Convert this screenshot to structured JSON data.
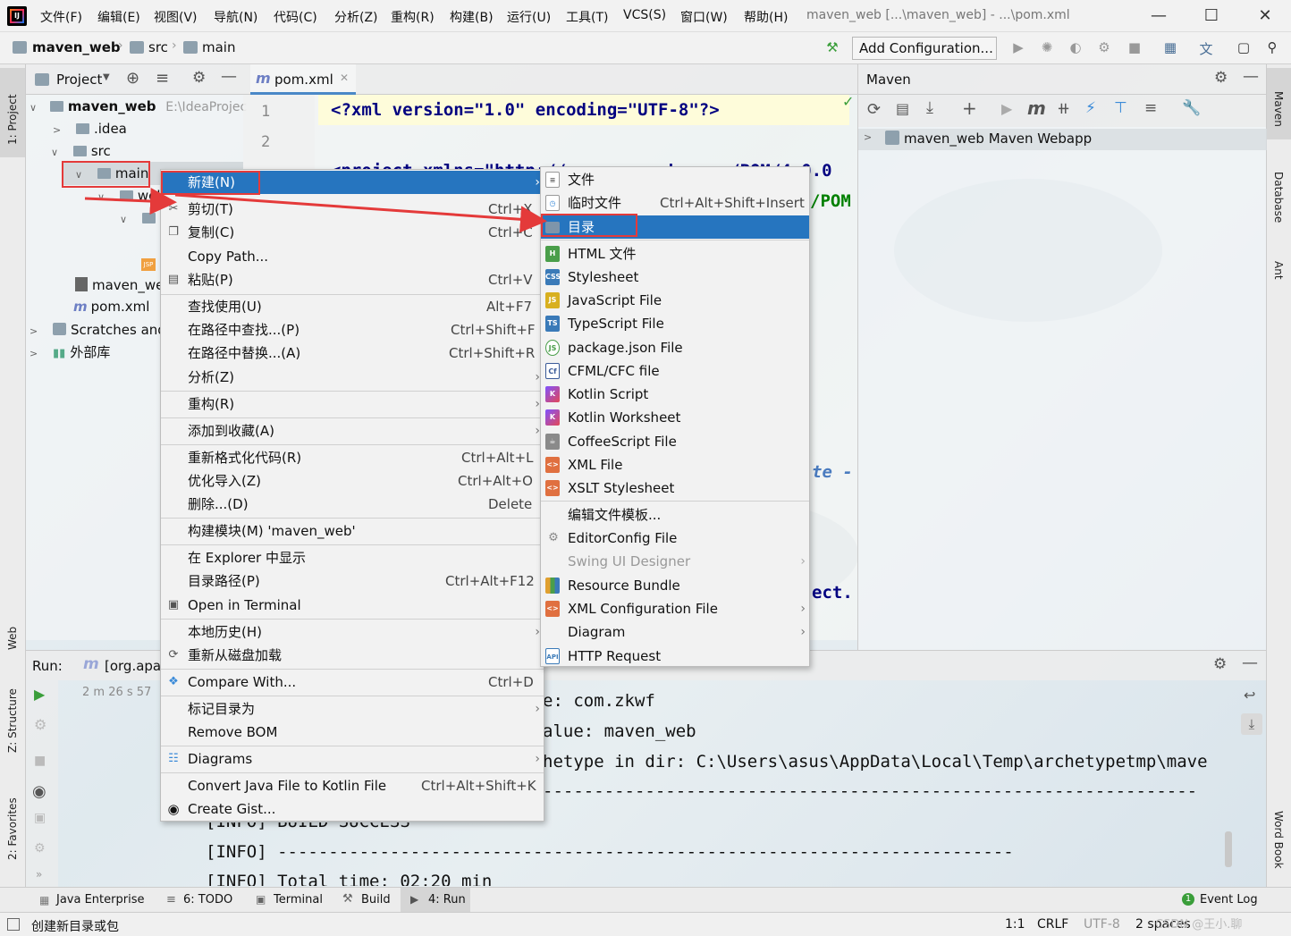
{
  "menubar": {
    "items": [
      "文件(F)",
      "编辑(E)",
      "视图(V)",
      "导航(N)",
      "代码(C)",
      "分析(Z)",
      "重构(R)",
      "构建(B)",
      "运行(U)",
      "工具(T)",
      "VCS(S)",
      "窗口(W)",
      "帮助(H)"
    ],
    "window_title": "maven_web [...\\maven_web] - ...\\pom.xml"
  },
  "navbar": {
    "crumbs": [
      "maven_web",
      "src",
      "main"
    ],
    "add_config": "Add Configuration..."
  },
  "left_stripe": {
    "project": "1: Project",
    "web": "Web",
    "structure": "Z: Structure",
    "favorites": "2: Favorites"
  },
  "right_stripe": {
    "maven": "Maven",
    "database": "Database",
    "ant": "Ant",
    "wordbook": "Word Book"
  },
  "project": {
    "title": "Project",
    "tree": {
      "root": "maven_web",
      "root_path": "E:\\IdeaProjec",
      "idea": ".idea",
      "src": "src",
      "main": "main",
      "web": "web",
      "iml": "maven_we",
      "pom": "pom.xml",
      "scratches": "Scratches and",
      "extlib": "外部库"
    }
  },
  "editor": {
    "tab": "pom.xml",
    "line1": "1",
    "line2": "2",
    "code_line1": "<?xml version=\"1.0\" encoding=\"UTF-8\"?>",
    "code_line3_frag": "<project xmlns=\"http://maven.apache.org/POM/4.0.0",
    "frag_pom": "/POM",
    "frag_te": "te -",
    "frag_ect": "ect."
  },
  "maven": {
    "title": "Maven",
    "project": "maven_web Maven Webapp"
  },
  "run": {
    "label": "Run:",
    "config": "[org.apa",
    "time": "2 m 26 s 57",
    "lines": [
      "e: com.zkwf",
      "alue: maven_web",
      "hetype in dir: C:\\Users\\asus\\AppData\\Local\\Temp\\archetypetmp\\mave",
      "----------------------------------------------------------------",
      "[INFO] BUILD SUCCESS",
      "[INFO] ------------------------------------------------------------------------",
      "[INFO] Total time: 02:20 min"
    ]
  },
  "context_menu": [
    {
      "label": "新建(N)",
      "submenu": true,
      "selected": true
    },
    {
      "label": "剪切(T)",
      "shortcut": "Ctrl+X",
      "icon": "scissors-icon"
    },
    {
      "label": "复制(C)",
      "shortcut": "Ctrl+C",
      "icon": "copy-icon"
    },
    {
      "label": "Copy Path..."
    },
    {
      "label": "粘贴(P)",
      "shortcut": "Ctrl+V",
      "icon": "paste-icon"
    },
    {
      "label": "查找使用(U)",
      "shortcut": "Alt+F7"
    },
    {
      "label": "在路径中查找...(P)",
      "shortcut": "Ctrl+Shift+F"
    },
    {
      "label": "在路径中替换...(A)",
      "shortcut": "Ctrl+Shift+R"
    },
    {
      "label": "分析(Z)",
      "submenu": true
    },
    {
      "label": "重构(R)",
      "submenu": true
    },
    {
      "label": "添加到收藏(A)",
      "submenu": true
    },
    {
      "label": "重新格式化代码(R)",
      "shortcut": "Ctrl+Alt+L"
    },
    {
      "label": "优化导入(Z)",
      "shortcut": "Ctrl+Alt+O"
    },
    {
      "label": "删除...(D)",
      "shortcut": "Delete"
    },
    {
      "label": "构建模块(M) 'maven_web'"
    },
    {
      "label": "在 Explorer 中显示"
    },
    {
      "label": "目录路径(P)",
      "shortcut": "Ctrl+Alt+F12"
    },
    {
      "label": "Open in Terminal",
      "icon": "terminal-icon"
    },
    {
      "label": "本地历史(H)",
      "submenu": true
    },
    {
      "label": "重新从磁盘加载",
      "icon": "reload-icon"
    },
    {
      "label": "Compare With...",
      "shortcut": "Ctrl+D",
      "icon": "compare-icon"
    },
    {
      "label": "标记目录为",
      "submenu": true
    },
    {
      "label": "Remove BOM"
    },
    {
      "label": "Diagrams",
      "submenu": true,
      "icon": "diagram-icon"
    },
    {
      "label": "Convert Java File to Kotlin File",
      "shortcut": "Ctrl+Alt+Shift+K"
    },
    {
      "label": "Create Gist...",
      "icon": "github-icon"
    }
  ],
  "new_submenu": [
    {
      "label": "文件",
      "icon": "file"
    },
    {
      "label": "临时文件",
      "shortcut": "Ctrl+Alt+Shift+Insert",
      "icon": "scratch"
    },
    {
      "label": "目录",
      "icon": "folder",
      "selected": true
    },
    {
      "label": "HTML 文件",
      "icon": "html",
      "badge": "H"
    },
    {
      "label": "Stylesheet",
      "icon": "css",
      "badge": "CSS"
    },
    {
      "label": "JavaScript File",
      "icon": "js",
      "badge": "JS"
    },
    {
      "label": "TypeScript File",
      "icon": "ts",
      "badge": "TS"
    },
    {
      "label": "package.json File",
      "icon": "json",
      "badge": "JS"
    },
    {
      "label": "CFML/CFC file",
      "icon": "cf",
      "badge": "Cf"
    },
    {
      "label": "Kotlin Script",
      "icon": "kotlin"
    },
    {
      "label": "Kotlin Worksheet",
      "icon": "kotlin"
    },
    {
      "label": "CoffeeScript File",
      "icon": "coffee"
    },
    {
      "label": "XML File",
      "icon": "xml",
      "badge": "<>"
    },
    {
      "label": "XSLT Stylesheet",
      "icon": "xslt",
      "badge": "<>"
    },
    {
      "label": "编辑文件模板..."
    },
    {
      "label": "EditorConfig File",
      "icon": "gear"
    },
    {
      "label": "Swing UI Designer",
      "submenu": true,
      "disabled": true
    },
    {
      "label": "Resource Bundle",
      "icon": "bundle"
    },
    {
      "label": "XML Configuration File",
      "submenu": true,
      "icon": "xml",
      "badge": "<>"
    },
    {
      "label": "Diagram",
      "submenu": true
    },
    {
      "label": "HTTP Request",
      "icon": "api",
      "badge": "API"
    }
  ],
  "bottom_tabs": [
    "Java Enterprise",
    "6: TODO",
    "Terminal",
    "Build",
    "4: Run"
  ],
  "event_log": "Event Log",
  "status": {
    "message": "创建新目录或包",
    "position": "1:1",
    "line_sep": "CRLF",
    "encoding": "UTF-8",
    "indent": "2 spaces",
    "watermark": "CSDN @王小.聊"
  },
  "colors": {
    "selection": "#2675bf",
    "annotation": "#e43a3a",
    "xml_tag": "#000080",
    "xml_value": "#008000"
  }
}
